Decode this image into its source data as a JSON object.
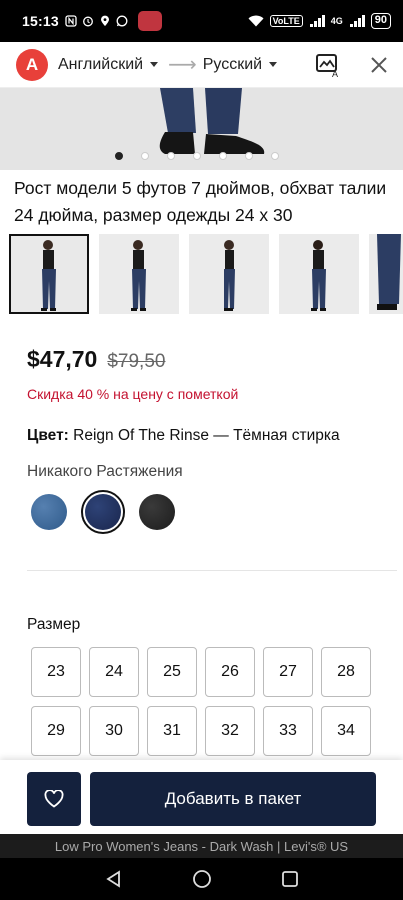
{
  "statusbar": {
    "time": "15:13",
    "volte": "VoLTE",
    "signal": "4G",
    "battery": "90"
  },
  "translator": {
    "source_lang": "Английский",
    "target_lang": "Русский"
  },
  "gallery": {
    "dots_total": 7,
    "active_dot": 0
  },
  "caption": "Рост модели 5 футов 7 дюймов, обхват талии 24 дюйма, размер одежды 24 х 30",
  "thumbnails": [
    "thumb-1",
    "thumb-2",
    "thumb-3",
    "thumb-4",
    "thumb-5"
  ],
  "price": {
    "current": "$47,70",
    "old": "$79,50",
    "discount": "Скидка 40 % на цену с пометкой"
  },
  "color": {
    "label": "Цвет:",
    "value": "Reign Of The Rinse — Тёмная стирка"
  },
  "stretch": "Никакого Растяжения",
  "swatches": [
    {
      "name": "medium-wash",
      "color": "#3b6a9e"
    },
    {
      "name": "dark-wash",
      "color": "#1f2f5c",
      "selected": true
    },
    {
      "name": "black",
      "color": "#2a2a2a"
    }
  ],
  "size": {
    "label": "Размер",
    "options": [
      "23",
      "24",
      "25",
      "26",
      "27",
      "28",
      "29",
      "30",
      "31",
      "32",
      "33",
      "34"
    ]
  },
  "actions": {
    "add_to_bag": "Добавить в пакет"
  },
  "page_url_title": "Low Pro Women's Jeans - Dark Wash | Levi's® US",
  "colors": {
    "accent": "#14213d",
    "discount": "#c41230"
  }
}
